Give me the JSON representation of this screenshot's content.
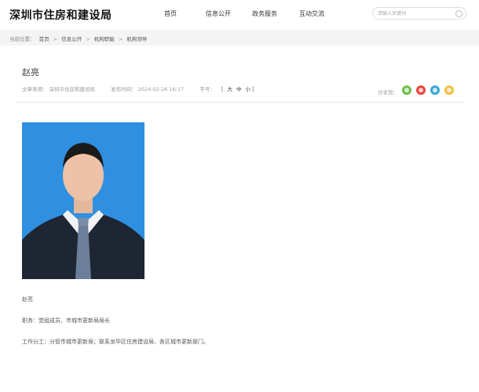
{
  "header": {
    "site_title": "深圳市住房和建设局",
    "nav": [
      "首页",
      "信息公开",
      "政务服务",
      "互动交流"
    ],
    "search_placeholder": "请输入关键词"
  },
  "breadcrumb": {
    "prefix": "当前位置：",
    "items": [
      "首页",
      "信息公开",
      "机构职能",
      "机构领导"
    ],
    "separator": ">"
  },
  "article": {
    "title": "赵亮",
    "source_label": "文章来源：",
    "source_value": "深圳市住房和建设局",
    "date_label": "发布时间：",
    "date_value": "2024-02-26 16:17",
    "fontsize_label": "字号：",
    "fontsize_open": "【",
    "fontsize_options": [
      "大",
      "中",
      "小"
    ],
    "fontsize_close": "】",
    "share_label": "分享到："
  },
  "share_icons": [
    "wechat-icon",
    "weibo-icon",
    "qq-zone-icon",
    "share-more-icon"
  ],
  "content": {
    "name": "赵亮",
    "position": "职务：党组成员、市城市更新局局长",
    "duties": "工作分工：分管市城市更新局；联系龙华区住房建设局、各区城市更新部门。"
  },
  "colors": {
    "photo_background": "#2f8fe0",
    "breadcrumb_bar": "#f4f4f4"
  }
}
